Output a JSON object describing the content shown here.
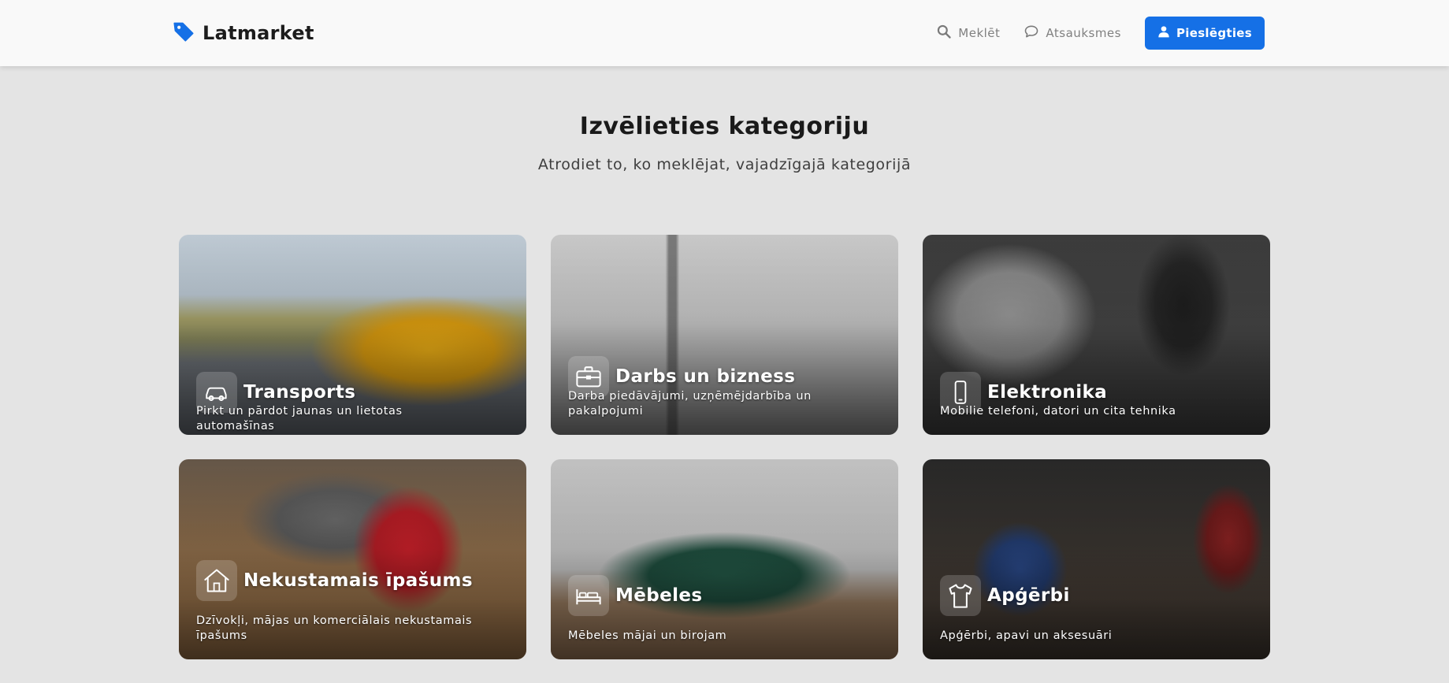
{
  "header": {
    "brand": "Latmarket",
    "nav": [
      {
        "label": "Meklēt",
        "icon": "search-icon"
      },
      {
        "label": "Atsauksmes",
        "icon": "chat-bubble-icon"
      }
    ],
    "login_label": "Pieslēgties",
    "accent": "#1570e6"
  },
  "main": {
    "title": "Izvēlieties kategoriju",
    "subtitle": "Atrodiet to, ko meklējat, vajadzīgajā kategorijā"
  },
  "categories": [
    {
      "title": "Transports",
      "description": "Pirkt un pārdot jaunas un lietotas automašīnas",
      "icon": "car-icon"
    },
    {
      "title": "Darbs un bizness",
      "description": "Darba piedāvājumi, uzņēmējdarbība un pakalpojumi",
      "icon": "briefcase-icon"
    },
    {
      "title": "Elektronika",
      "description": "Mobilie telefoni, datori un cita tehnika",
      "icon": "smartphone-icon"
    },
    {
      "title": "Nekustamais īpašums",
      "description": "Dzīvokļi, mājas un komerciālais nekustamais īpašums",
      "icon": "house-icon"
    },
    {
      "title": "Mēbeles",
      "description": "Mēbeles mājai un birojam",
      "icon": "bed-icon"
    },
    {
      "title": "Apģērbi",
      "description": "Apģērbi, apavi un aksesuāri",
      "icon": "tshirt-icon"
    }
  ]
}
